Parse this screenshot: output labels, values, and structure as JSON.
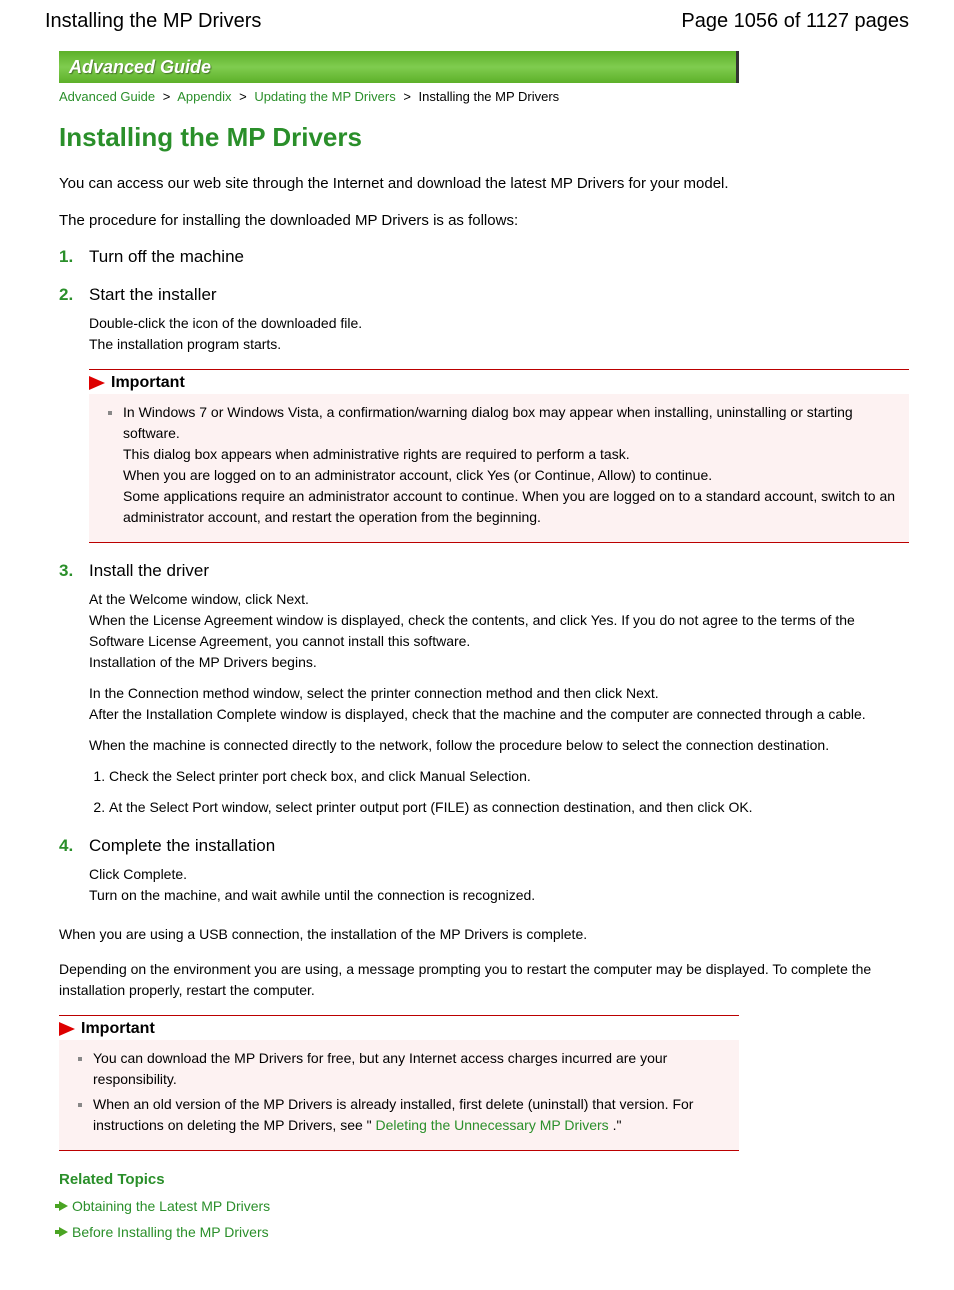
{
  "header": {
    "title": "Installing the MP Drivers",
    "page_info": "Page 1056 of 1127 pages"
  },
  "banner": "Advanced Guide",
  "breadcrumb": {
    "items": [
      "Advanced Guide",
      "Appendix",
      "Updating the MP Drivers"
    ],
    "current": "Installing the MP Drivers"
  },
  "page_title": "Installing the MP Drivers",
  "intro": [
    "You can access our web site through the Internet and download the latest MP Drivers for your model.",
    "The procedure for installing the downloaded MP Drivers is as follows:"
  ],
  "steps": [
    {
      "num": "1.",
      "title": "Turn off the machine"
    },
    {
      "num": "2.",
      "title": "Start the installer",
      "body_lines": [
        "Double-click the icon of the downloaded file.",
        "The installation program starts."
      ],
      "important": {
        "label": "Important",
        "items": [
          "In Windows 7 or Windows Vista, a confirmation/warning dialog box may appear when installing, uninstalling or starting software.\nThis dialog box appears when administrative rights are required to perform a task.\nWhen you are logged on to an administrator account, click Yes (or Continue, Allow) to continue.\nSome applications require an administrator account to continue. When you are logged on to a standard account, switch to an administrator account, and restart the operation from the beginning."
        ]
      }
    },
    {
      "num": "3.",
      "title": "Install the driver",
      "paras": [
        "At the Welcome window, click Next.\nWhen the License Agreement window is displayed, check the contents, and click Yes. If you do not agree to the terms of the Software License Agreement, you cannot install this software.\nInstallation of the MP Drivers begins.",
        "In the Connection method window, select the printer connection method and then click Next.\nAfter the Installation Complete window is displayed, check that the machine and the computer are connected through a cable.",
        "When the machine is connected directly to the network, follow the procedure below to select the connection destination."
      ],
      "sublist": [
        "Check the Select printer port check box, and click Manual Selection.",
        "At the Select Port window, select printer output port (FILE) as connection destination, and then click OK."
      ]
    },
    {
      "num": "4.",
      "title": "Complete the installation",
      "body_lines": [
        "Click Complete.",
        "Turn on the machine, and wait awhile until the connection is recognized."
      ]
    }
  ],
  "after_steps": [
    "When you are using a USB connection, the installation of the MP Drivers is complete.",
    "Depending on the environment you are using, a message prompting you to restart the computer may be displayed. To complete the installation properly, restart the computer."
  ],
  "important2": {
    "label": "Important",
    "items": [
      "You can download the MP Drivers for free, but any Internet access charges incurred are your responsibility.",
      "When an old version of the MP Drivers is already installed, first delete (uninstall) that version. For instructions on deleting the MP Drivers, see \" "
    ],
    "link_text": "Deleting the Unnecessary MP Drivers ",
    "after_link": ".\""
  },
  "related": {
    "title": "Related Topics",
    "links": [
      "Obtaining the Latest MP Drivers",
      "Before Installing the MP Drivers"
    ]
  }
}
